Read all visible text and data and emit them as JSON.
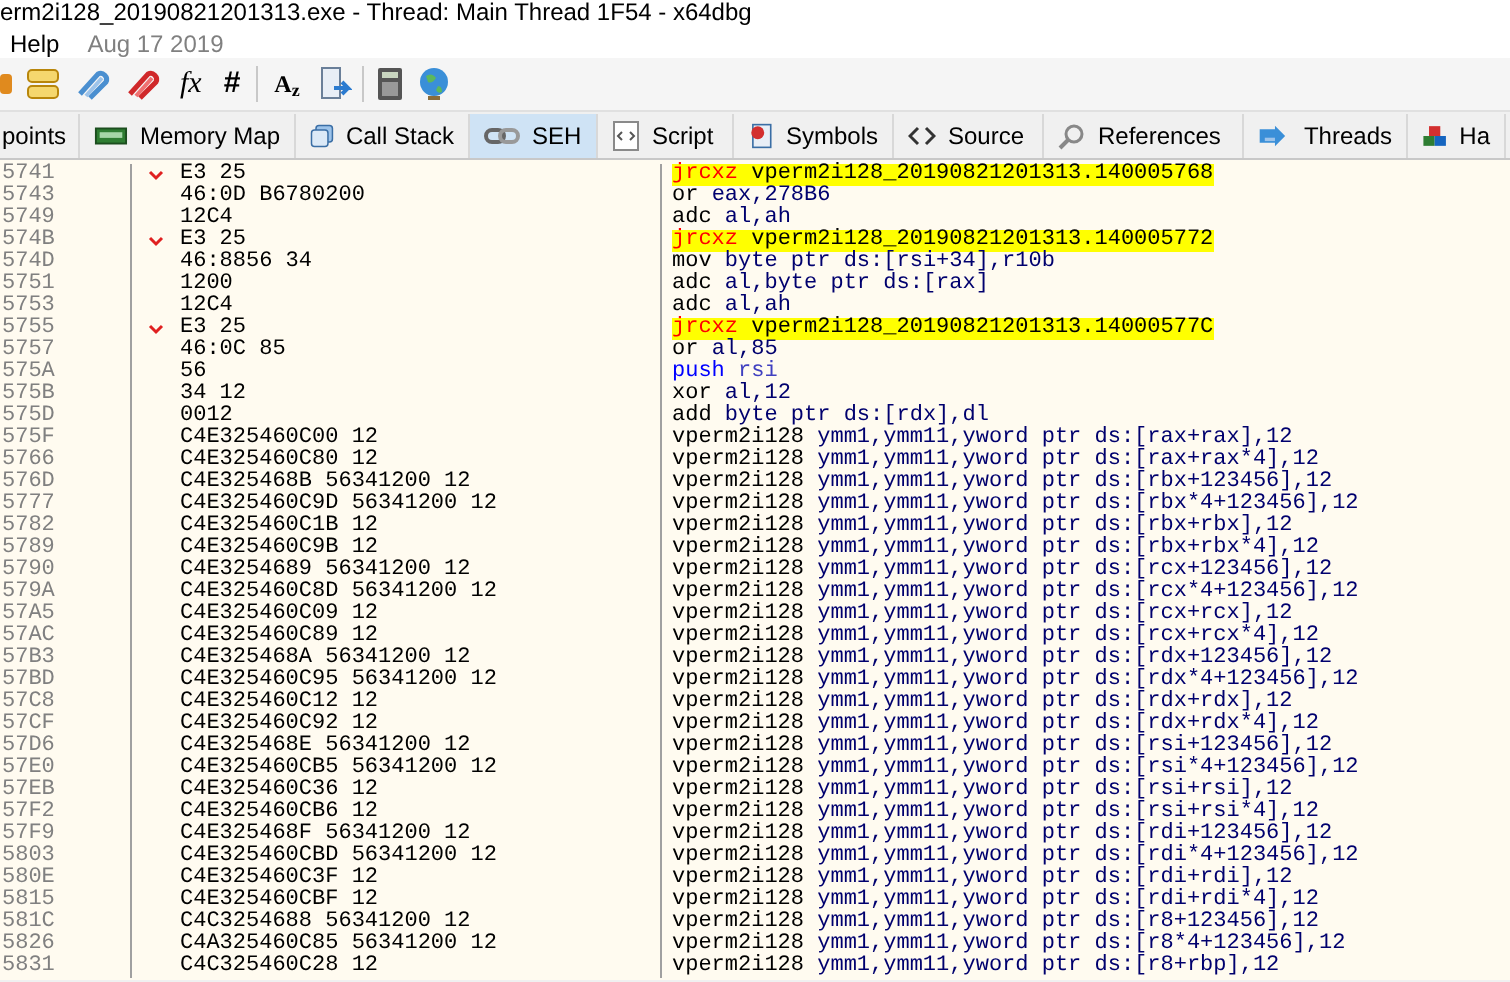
{
  "window": {
    "title": "erm2i128_20190821201313.exe - Thread: Main Thread 1F54 - x64dbg"
  },
  "menu": {
    "items": [
      "Help"
    ],
    "build_date": "Aug 17 2019"
  },
  "toolbar": {
    "glyphs": [
      "fx",
      "#",
      "A$_{z}$"
    ]
  },
  "tabs": [
    {
      "label": "points",
      "selected": false
    },
    {
      "label": "Memory Map",
      "selected": false
    },
    {
      "label": "Call Stack",
      "selected": false
    },
    {
      "label": "SEH",
      "selected": true
    },
    {
      "label": "Script",
      "selected": false
    },
    {
      "label": "Symbols",
      "selected": false
    },
    {
      "label": "Source",
      "selected": false
    },
    {
      "label": "References",
      "selected": false
    },
    {
      "label": "Threads",
      "selected": false
    },
    {
      "label": "Ha",
      "selected": false
    }
  ],
  "listing": {
    "rows": [
      {
        "address": "5741",
        "bytes": "E3 25",
        "mnemonic": "jrcxz",
        "operands": "vperm2i128_20190821201313.140005768",
        "kind": "jump"
      },
      {
        "address": "5743",
        "bytes": "46:0D B6780200",
        "mnemonic": "or",
        "operands": "eax,278B6",
        "kind": "normal"
      },
      {
        "address": "5749",
        "bytes": "12C4",
        "mnemonic": "adc",
        "operands": "al,ah",
        "kind": "normal"
      },
      {
        "address": "574B",
        "bytes": "E3 25",
        "mnemonic": "jrcxz",
        "operands": "vperm2i128_20190821201313.140005772",
        "kind": "jump"
      },
      {
        "address": "574D",
        "bytes": "46:8856 34",
        "mnemonic": "mov",
        "operands": "byte ptr ds:[rsi+34],r10b",
        "kind": "normal"
      },
      {
        "address": "5751",
        "bytes": "1200",
        "mnemonic": "adc",
        "operands": "al,byte ptr ds:[rax]",
        "kind": "normal"
      },
      {
        "address": "5753",
        "bytes": "12C4",
        "mnemonic": "adc",
        "operands": "al,ah",
        "kind": "normal"
      },
      {
        "address": "5755",
        "bytes": "E3 25",
        "mnemonic": "jrcxz",
        "operands": "vperm2i128_20190821201313.14000577C",
        "kind": "jump"
      },
      {
        "address": "5757",
        "bytes": "46:0C 85",
        "mnemonic": "or",
        "operands": "al,85",
        "kind": "normal"
      },
      {
        "address": "575A",
        "bytes": "56",
        "mnemonic": "push",
        "operands": "rsi",
        "kind": "stack"
      },
      {
        "address": "575B",
        "bytes": "34 12",
        "mnemonic": "xor",
        "operands": "al,12",
        "kind": "normal"
      },
      {
        "address": "575D",
        "bytes": "0012",
        "mnemonic": "add",
        "operands": "byte ptr ds:[rdx],dl",
        "kind": "normal"
      },
      {
        "address": "575F",
        "bytes": "C4E325460C00 12",
        "mnemonic": "vperm2i128",
        "operands": "ymm1,ymm11,yword ptr ds:[rax+rax],12",
        "kind": "normal"
      },
      {
        "address": "5766",
        "bytes": "C4E325460C80 12",
        "mnemonic": "vperm2i128",
        "operands": "ymm1,ymm11,yword ptr ds:[rax+rax*4],12",
        "kind": "normal"
      },
      {
        "address": "576D",
        "bytes": "C4E325468B 56341200 12",
        "mnemonic": "vperm2i128",
        "operands": "ymm1,ymm11,yword ptr ds:[rbx+123456],12",
        "kind": "normal"
      },
      {
        "address": "5777",
        "bytes": "C4E325460C9D 56341200 12",
        "mnemonic": "vperm2i128",
        "operands": "ymm1,ymm11,yword ptr ds:[rbx*4+123456],12",
        "kind": "normal"
      },
      {
        "address": "5782",
        "bytes": "C4E325460C1B 12",
        "mnemonic": "vperm2i128",
        "operands": "ymm1,ymm11,yword ptr ds:[rbx+rbx],12",
        "kind": "normal"
      },
      {
        "address": "5789",
        "bytes": "C4E325460C9B 12",
        "mnemonic": "vperm2i128",
        "operands": "ymm1,ymm11,yword ptr ds:[rbx+rbx*4],12",
        "kind": "normal"
      },
      {
        "address": "5790",
        "bytes": "C4E3254689 56341200 12",
        "mnemonic": "vperm2i128",
        "operands": "ymm1,ymm11,yword ptr ds:[rcx+123456],12",
        "kind": "normal"
      },
      {
        "address": "579A",
        "bytes": "C4E325460C8D 56341200 12",
        "mnemonic": "vperm2i128",
        "operands": "ymm1,ymm11,yword ptr ds:[rcx*4+123456],12",
        "kind": "normal"
      },
      {
        "address": "57A5",
        "bytes": "C4E325460C09 12",
        "mnemonic": "vperm2i128",
        "operands": "ymm1,ymm11,yword ptr ds:[rcx+rcx],12",
        "kind": "normal"
      },
      {
        "address": "57AC",
        "bytes": "C4E325460C89 12",
        "mnemonic": "vperm2i128",
        "operands": "ymm1,ymm11,yword ptr ds:[rcx+rcx*4],12",
        "kind": "normal"
      },
      {
        "address": "57B3",
        "bytes": "C4E325468A 56341200 12",
        "mnemonic": "vperm2i128",
        "operands": "ymm1,ymm11,yword ptr ds:[rdx+123456],12",
        "kind": "normal"
      },
      {
        "address": "57BD",
        "bytes": "C4E325460C95 56341200 12",
        "mnemonic": "vperm2i128",
        "operands": "ymm1,ymm11,yword ptr ds:[rdx*4+123456],12",
        "kind": "normal"
      },
      {
        "address": "57C8",
        "bytes": "C4E325460C12 12",
        "mnemonic": "vperm2i128",
        "operands": "ymm1,ymm11,yword ptr ds:[rdx+rdx],12",
        "kind": "normal"
      },
      {
        "address": "57CF",
        "bytes": "C4E325460C92 12",
        "mnemonic": "vperm2i128",
        "operands": "ymm1,ymm11,yword ptr ds:[rdx+rdx*4],12",
        "kind": "normal"
      },
      {
        "address": "57D6",
        "bytes": "C4E325468E 56341200 12",
        "mnemonic": "vperm2i128",
        "operands": "ymm1,ymm11,yword ptr ds:[rsi+123456],12",
        "kind": "normal"
      },
      {
        "address": "57E0",
        "bytes": "C4E325460CB5 56341200 12",
        "mnemonic": "vperm2i128",
        "operands": "ymm1,ymm11,yword ptr ds:[rsi*4+123456],12",
        "kind": "normal"
      },
      {
        "address": "57EB",
        "bytes": "C4E325460C36 12",
        "mnemonic": "vperm2i128",
        "operands": "ymm1,ymm11,yword ptr ds:[rsi+rsi],12",
        "kind": "normal"
      },
      {
        "address": "57F2",
        "bytes": "C4E325460CB6 12",
        "mnemonic": "vperm2i128",
        "operands": "ymm1,ymm11,yword ptr ds:[rsi+rsi*4],12",
        "kind": "normal"
      },
      {
        "address": "57F9",
        "bytes": "C4E325468F 56341200 12",
        "mnemonic": "vperm2i128",
        "operands": "ymm1,ymm11,yword ptr ds:[rdi+123456],12",
        "kind": "normal"
      },
      {
        "address": "5803",
        "bytes": "C4E325460CBD 56341200 12",
        "mnemonic": "vperm2i128",
        "operands": "ymm1,ymm11,yword ptr ds:[rdi*4+123456],12",
        "kind": "normal"
      },
      {
        "address": "580E",
        "bytes": "C4E325460C3F 12",
        "mnemonic": "vperm2i128",
        "operands": "ymm1,ymm11,yword ptr ds:[rdi+rdi],12",
        "kind": "normal"
      },
      {
        "address": "5815",
        "bytes": "C4E325460CBF 12",
        "mnemonic": "vperm2i128",
        "operands": "ymm1,ymm11,yword ptr ds:[rdi+rdi*4],12",
        "kind": "normal"
      },
      {
        "address": "581C",
        "bytes": "C4C3254688 56341200 12",
        "mnemonic": "vperm2i128",
        "operands": "ymm1,ymm11,yword ptr ds:[r8+123456],12",
        "kind": "normal"
      },
      {
        "address": "5826",
        "bytes": "C4A325460C85 56341200 12",
        "mnemonic": "vperm2i128",
        "operands": "ymm1,ymm11,yword ptr ds:[r8*4+123456],12",
        "kind": "normal"
      },
      {
        "address": "5831",
        "bytes": "C4C325460C28 12",
        "mnemonic": "vperm2i128",
        "operands": "ymm1,ymm11,yword ptr ds:[r8+rbp],12",
        "kind": "normal"
      }
    ]
  }
}
